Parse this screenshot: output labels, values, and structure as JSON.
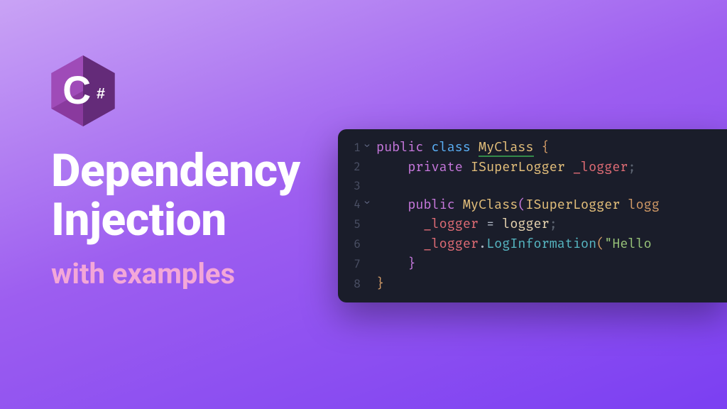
{
  "logo": {
    "letter": "C",
    "badge": "#",
    "fill_dark": "#5f2a74",
    "fill_mid": "#8a3a9e",
    "fill_light": "#a24fbc"
  },
  "heading": {
    "line1": "Dependency",
    "line2": "Injection",
    "subtitle": "with examples"
  },
  "code": {
    "lines": [
      {
        "num": "1",
        "fold": "⌄",
        "tokens": [
          {
            "t": "public ",
            "c": "tok-kw"
          },
          {
            "t": "class ",
            "c": "tok-kw2"
          },
          {
            "t": "MyClass",
            "c": "tok-type tok-wave"
          },
          {
            "t": " {",
            "c": "tok-brace"
          }
        ]
      },
      {
        "num": "2",
        "fold": "",
        "tokens": [
          {
            "t": "    ",
            "c": ""
          },
          {
            "t": "private ",
            "c": "tok-kw"
          },
          {
            "t": "ISuperLogger ",
            "c": "tok-type"
          },
          {
            "t": "_logger",
            "c": "tok-field"
          },
          {
            "t": ";",
            "c": "tok-semi"
          }
        ]
      },
      {
        "num": "3",
        "fold": "",
        "tokens": []
      },
      {
        "num": "4",
        "fold": "⌄",
        "tokens": [
          {
            "t": "    ",
            "c": ""
          },
          {
            "t": "public ",
            "c": "tok-kw"
          },
          {
            "t": "MyClass",
            "c": "tok-type"
          },
          {
            "t": "(",
            "c": "tok-brace2"
          },
          {
            "t": "ISuperLogger ",
            "c": "tok-type"
          },
          {
            "t": "logg",
            "c": "tok-param"
          }
        ]
      },
      {
        "num": "5",
        "fold": "",
        "tokens": [
          {
            "t": "      ",
            "c": ""
          },
          {
            "t": "_logger",
            "c": "tok-field"
          },
          {
            "t": " = ",
            "c": "tok-punc"
          },
          {
            "t": "logger",
            "c": "tok-ident"
          },
          {
            "t": ";",
            "c": "tok-semi"
          }
        ]
      },
      {
        "num": "6",
        "fold": "",
        "tokens": [
          {
            "t": "      ",
            "c": ""
          },
          {
            "t": "_logger",
            "c": "tok-field"
          },
          {
            "t": ".",
            "c": "tok-punc"
          },
          {
            "t": "LogInformation",
            "c": "tok-fn"
          },
          {
            "t": "(",
            "c": "tok-brace"
          },
          {
            "t": "\"Hello ",
            "c": "tok-str"
          }
        ]
      },
      {
        "num": "7",
        "fold": "",
        "tokens": [
          {
            "t": "    ",
            "c": ""
          },
          {
            "t": "}",
            "c": "tok-brace2"
          }
        ]
      },
      {
        "num": "8",
        "fold": "",
        "tokens": [
          {
            "t": "}",
            "c": "tok-brace"
          }
        ]
      }
    ]
  }
}
